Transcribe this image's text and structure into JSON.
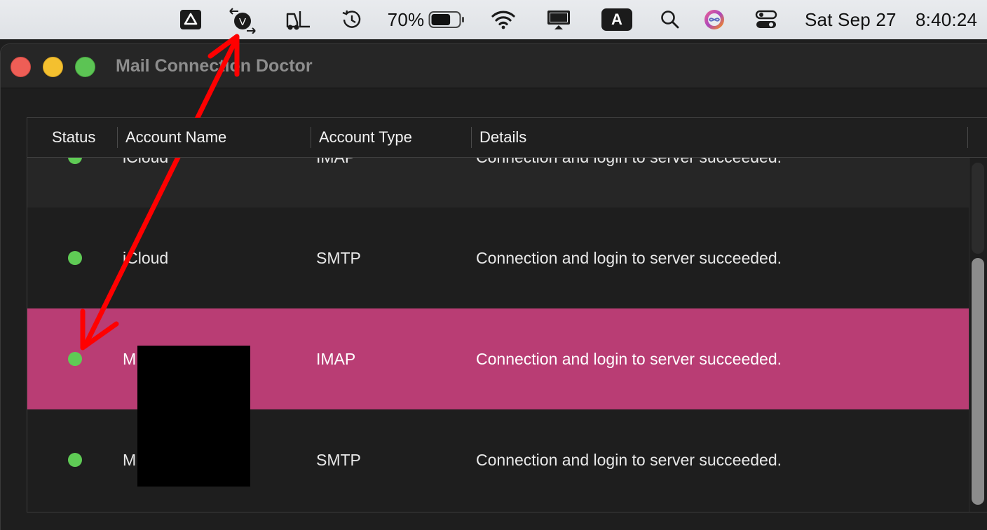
{
  "menubar": {
    "icons": [
      "google-drive-icon",
      "vpn-icon",
      "forklift-icon",
      "time-machine-icon",
      "battery-icon",
      "wifi-icon",
      "screen-mirroring-icon",
      "input-source-icon",
      "search-icon",
      "siri-icon",
      "control-center-icon"
    ],
    "battery_percent": "70%",
    "battery_level": 0.7,
    "input_source": "A",
    "date": "Sat Sep 27",
    "time": "8:40:24"
  },
  "window": {
    "title": "Mail Connection Doctor"
  },
  "table": {
    "columns": [
      "Status",
      "Account Name",
      "Account Type",
      "Details"
    ],
    "rows": [
      {
        "status_color": "#5fcb55",
        "account_name": "iCloud",
        "account_type": "IMAP",
        "details": "Connection and login to server succeeded."
      },
      {
        "status_color": "#5fcb55",
        "account_name": "iCloud",
        "account_type": "SMTP",
        "details": "Connection and login to server succeeded."
      },
      {
        "status_color": "#5fcb55",
        "account_name": "M",
        "account_type": "IMAP",
        "details": "Connection and login to server succeeded.",
        "selected": true
      },
      {
        "status_color": "#5fcb55",
        "account_name": "M",
        "account_type": "SMTP",
        "details": "Connection and login to server succeeded."
      }
    ]
  },
  "colors": {
    "selection": "#b93d74",
    "status_ok": "#5fcb55",
    "annotation_arrow": "#ff0000"
  }
}
